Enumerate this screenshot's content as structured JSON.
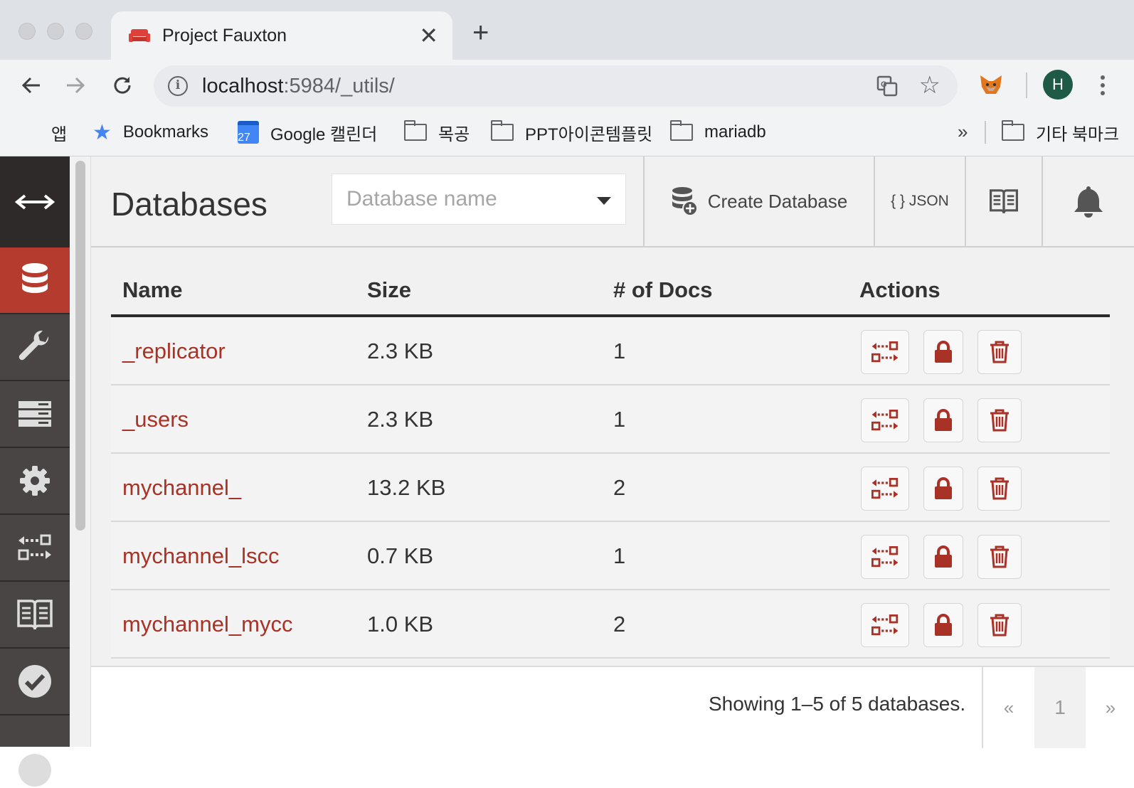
{
  "browser": {
    "tab": {
      "title": "Project Fauxton",
      "close": "✕"
    },
    "new_tab": "+",
    "url": {
      "host": "localhost",
      "rest": ":5984/_utils/"
    },
    "profile_initial": "H",
    "bookmarks": [
      {
        "label": "앱",
        "icon": "apps-grid-icon"
      },
      {
        "label": "Bookmarks",
        "icon": "star-icon"
      },
      {
        "label": "Google 캘린더",
        "icon": "calendar-icon",
        "badge": "27"
      },
      {
        "label": "목공",
        "icon": "folder-icon"
      },
      {
        "label": "PPT아이콘템플릿",
        "icon": "folder-icon"
      },
      {
        "label": "mariadb",
        "icon": "folder-icon"
      }
    ],
    "bookmarks_overflow": "»",
    "other_bookmarks": "기타 북마크"
  },
  "colors": {
    "brand_red": "#b53b2e",
    "sidebar": "#4a4545",
    "link": "#a93226"
  },
  "sidebar": {
    "items": [
      "toggle-icon",
      "database-icon",
      "wrench-icon",
      "server-icon",
      "gear-icon",
      "replication-icon",
      "documentation-icon",
      "verify-icon"
    ],
    "active": "database-icon"
  },
  "header": {
    "title": "Databases",
    "search_placeholder": "Database name",
    "create_label": "Create Database",
    "json_label": "{ } JSON"
  },
  "table": {
    "columns": [
      "Name",
      "Size",
      "# of Docs",
      "Actions"
    ],
    "rows": [
      {
        "name": "_replicator",
        "size": "2.3 KB",
        "docs": "1"
      },
      {
        "name": "_users",
        "size": "2.3 KB",
        "docs": "1"
      },
      {
        "name": "mychannel_",
        "size": "13.2 KB",
        "docs": "2"
      },
      {
        "name": "mychannel_lscc",
        "size": "0.7 KB",
        "docs": "1"
      },
      {
        "name": "mychannel_mycc",
        "size": "1.0 KB",
        "docs": "2"
      }
    ]
  },
  "footer": {
    "showing": "Showing 1–5 of 5 databases.",
    "prev": "«",
    "page": "1",
    "next": "»"
  }
}
